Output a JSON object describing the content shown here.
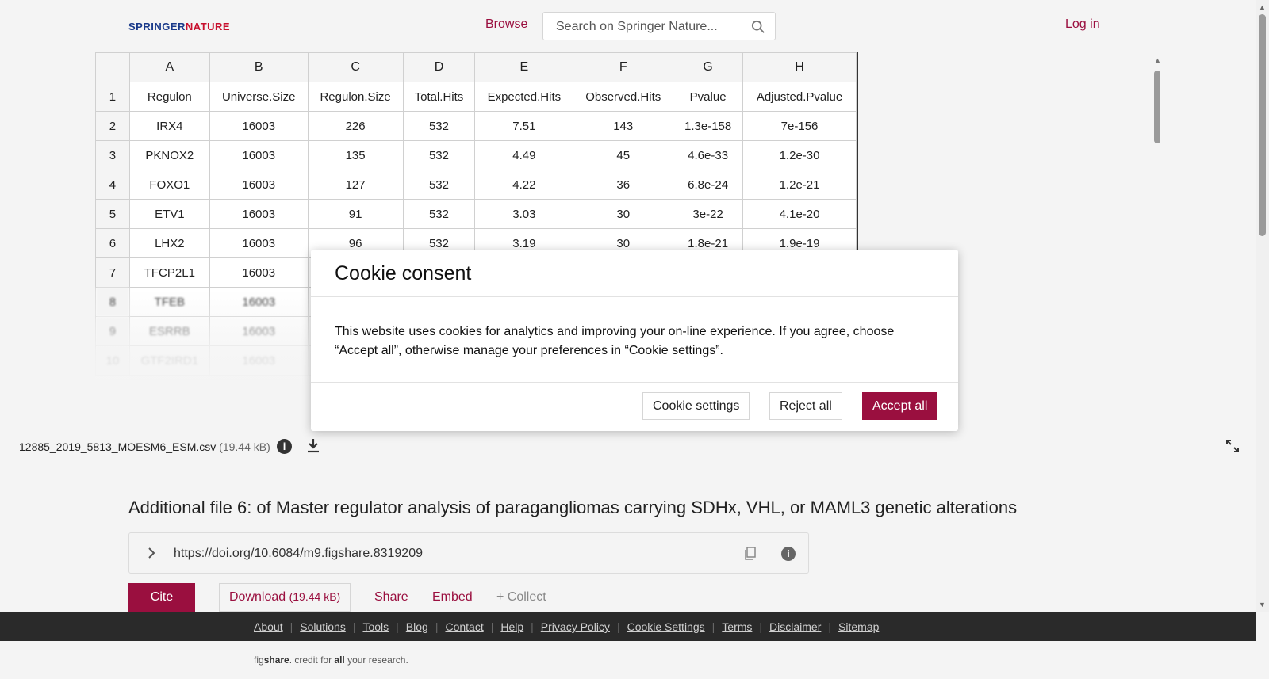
{
  "header": {
    "logo_part1": "SPRINGER",
    "logo_part2": "NATURE",
    "browse": "Browse",
    "search_placeholder": "Search on Springer Nature...",
    "login": "Log in"
  },
  "sheet": {
    "col_headers": [
      "A",
      "B",
      "C",
      "D",
      "E",
      "F",
      "G",
      "H"
    ],
    "rows": [
      {
        "n": "1",
        "cells": [
          "Regulon",
          "Universe.Size",
          "Regulon.Size",
          "Total.Hits",
          "Expected.Hits",
          "Observed.Hits",
          "Pvalue",
          "Adjusted.Pvalue"
        ]
      },
      {
        "n": "2",
        "cells": [
          "IRX4",
          "16003",
          "226",
          "532",
          "7.51",
          "143",
          "1.3e-158",
          "7e-156"
        ]
      },
      {
        "n": "3",
        "cells": [
          "PKNOX2",
          "16003",
          "135",
          "532",
          "4.49",
          "45",
          "4.6e-33",
          "1.2e-30"
        ]
      },
      {
        "n": "4",
        "cells": [
          "FOXO1",
          "16003",
          "127",
          "532",
          "4.22",
          "36",
          "6.8e-24",
          "1.2e-21"
        ]
      },
      {
        "n": "5",
        "cells": [
          "ETV1",
          "16003",
          "91",
          "532",
          "3.03",
          "30",
          "3e-22",
          "4.1e-20"
        ]
      },
      {
        "n": "6",
        "cells": [
          "LHX2",
          "16003",
          "96",
          "532",
          "3.19",
          "30",
          "1.8e-21",
          "1.9e-19"
        ]
      },
      {
        "n": "7",
        "cells": [
          "TFCP2L1",
          "16003",
          "",
          "",
          "",
          "",
          "",
          ""
        ]
      },
      {
        "n": "8",
        "cells": [
          "TFEB",
          "16003",
          "",
          "",
          "",
          "",
          "",
          ""
        ]
      },
      {
        "n": "9",
        "cells": [
          "ESRRB",
          "16003",
          "",
          "",
          "",
          "",
          "",
          ""
        ]
      },
      {
        "n": "10",
        "cells": [
          "GTF2IRD1",
          "16003",
          "",
          "",
          "",
          "",
          "",
          ""
        ]
      }
    ]
  },
  "file": {
    "name": "12885_2019_5813_MOESM6_ESM.csv",
    "size": "(19.44 kB)"
  },
  "article": {
    "title": "Additional file 6: of Master regulator analysis of paragangliomas carrying SDHx, VHL, or MAML3 genetic alterations",
    "doi": "https://doi.org/10.6084/m9.figshare.8319209"
  },
  "actions": {
    "cite": "Cite",
    "download": "Download",
    "download_size": "(19.44 kB)",
    "share": "Share",
    "embed": "Embed",
    "collect": "+ Collect"
  },
  "footer": {
    "links": [
      "About",
      "Solutions",
      "Tools",
      "Blog",
      "Contact",
      "Help",
      "Privacy Policy",
      "Cookie Settings",
      "Terms",
      "Disclaimer",
      "Sitemap"
    ],
    "tag_fig": "fig",
    "tag_share": "share",
    "tag_mid": ". credit for ",
    "tag_all": "all",
    "tag_end": " your research."
  },
  "modal": {
    "title": "Cookie consent",
    "text": "This website uses cookies for analytics and improving your on-line experience. If you agree, choose “Accept all”, otherwise manage your preferences in “Cookie settings”.",
    "settings": "Cookie settings",
    "reject": "Reject all",
    "accept": "Accept all"
  },
  "colors": {
    "accent": "#9a0f3f",
    "footer_bg": "#2a2a2a"
  }
}
